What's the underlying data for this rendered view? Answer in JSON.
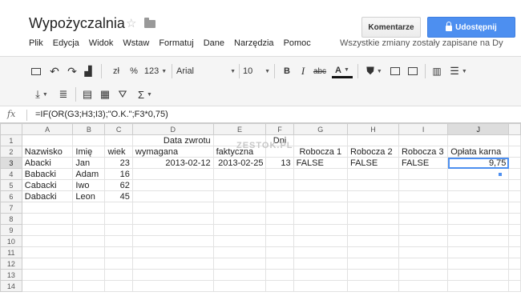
{
  "doc": {
    "title": "Wypożyczalnia"
  },
  "header": {
    "comments": "Komentarze",
    "share": "Udostępnij",
    "saved": "Wszystkie zmiany zostały zapisane na Dy"
  },
  "menu": [
    "Plik",
    "Edycja",
    "Widok",
    "Wstaw",
    "Formatuj",
    "Dane",
    "Narzędzia",
    "Pomoc"
  ],
  "toolbar": {
    "currency": "zł",
    "percent": "%",
    "numfmt": "123",
    "font": "Arial",
    "size": "10",
    "bold": "B",
    "italic": "I",
    "strike": "abc",
    "textcolor": "A",
    "sum": "Σ"
  },
  "formula": {
    "label": "fx",
    "value": "=IF(OR(G3;H3;I3);\"O.K.\";F3*0,75)"
  },
  "watermark": "ZESTOK.PL",
  "columns": [
    "A",
    "B",
    "C",
    "D",
    "E",
    "F",
    "G",
    "H",
    "I",
    "J"
  ],
  "rows": [
    "1",
    "2",
    "3",
    "4",
    "5",
    "6",
    "7",
    "8",
    "9",
    "10",
    "11",
    "12",
    "13",
    "14"
  ],
  "sheet": {
    "r1": {
      "D": "Data zwrotu",
      "F": "Dni"
    },
    "r2": {
      "A": "Nazwisko",
      "B": "Imię",
      "C": "wiek",
      "D": "wymagana",
      "E": "faktyczna",
      "G": "Robocza 1",
      "H": "Robocza 2",
      "I": "Robocza 3",
      "J": "Opłata karna"
    },
    "r3": {
      "A": "Abacki",
      "B": "Jan",
      "C": "23",
      "D": "2013-02-12",
      "E": "2013-02-25",
      "F": "13",
      "G": "FALSE",
      "H": "FALSE",
      "I": "FALSE",
      "J": "9,75"
    },
    "r4": {
      "A": "Babacki",
      "B": "Adam",
      "C": "16"
    },
    "r5": {
      "A": "Cabacki",
      "B": "Iwo",
      "C": "62"
    },
    "r6": {
      "A": "Dabacki",
      "B": "Leon",
      "C": "45"
    }
  }
}
